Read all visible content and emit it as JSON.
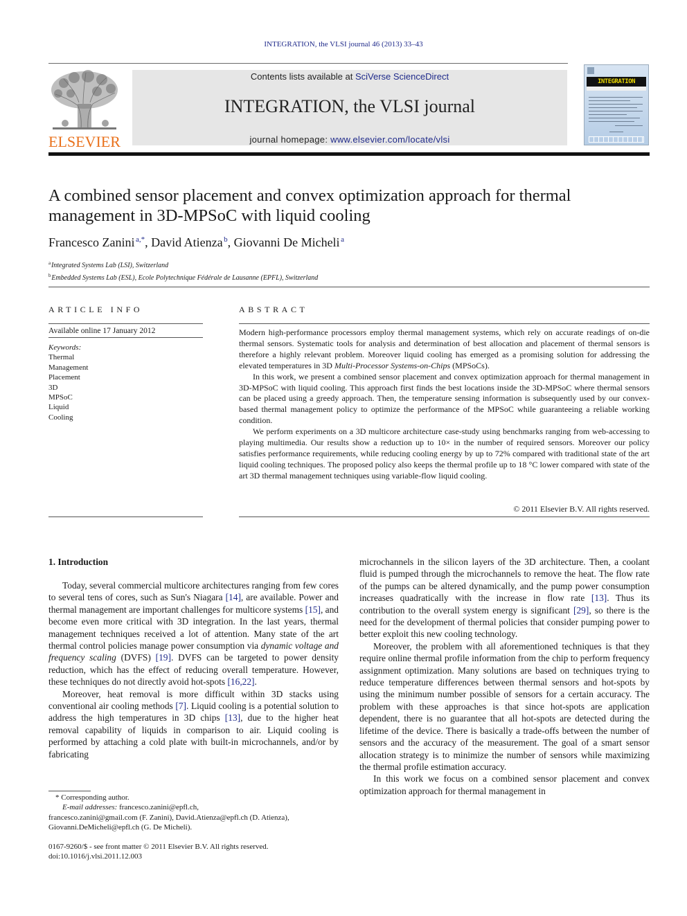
{
  "running_header": "INTEGRATION, the VLSI journal 46 (2013) 33–43",
  "publisher": {
    "logo_word": "ELSEVIER",
    "logo_color": "#e9711c"
  },
  "masthead": {
    "contents_prefix": "Contents lists available at ",
    "contents_link": "SciVerse ScienceDirect",
    "journal_name": "INTEGRATION, the VLSI journal",
    "homepage_prefix": "journal homepage: ",
    "homepage_link": "www.elsevier.com/locate/vlsi"
  },
  "cover": {
    "title": "INTEGRATION",
    "subtitle": "the VLSI journal"
  },
  "article": {
    "title": "A combined sensor placement and convex optimization approach for thermal management in 3D-MPSoC with liquid cooling",
    "authors": [
      {
        "name": "Francesco Zanini",
        "marks": "a,*"
      },
      {
        "name": "David Atienza",
        "marks": "b"
      },
      {
        "name": "Giovanni De Micheli",
        "marks": "a"
      }
    ],
    "affiliations": [
      {
        "mark": "a",
        "text": "Integrated Systems Lab (LSI), Switzerland"
      },
      {
        "mark": "b",
        "text": "Embedded Systems Lab (ESL), Ecole Polytechnique Fédérale de Lausanne (EPFL), Switzerland"
      }
    ]
  },
  "article_info": {
    "heading": "ARTICLE INFO",
    "available_online": "Available online 17 January 2012",
    "keywords_label": "Keywords:",
    "keywords": [
      "Thermal",
      "Management",
      "Placement",
      "3D",
      "MPSoC",
      "Liquid",
      "Cooling"
    ]
  },
  "abstract": {
    "heading": "ABSTRACT",
    "p1_a": "Modern high-performance processors employ thermal management systems, which rely on accurate readings of on-die thermal sensors. Systematic tools for analysis and determination of best allocation and placement of thermal sensors is therefore a highly relevant problem. Moreover liquid cooling has emerged as a promising solution for addressing the elevated temperatures in 3D ",
    "p1_italic": "Multi-Processor Systems-on-Chips",
    "p1_b": " (MPSoCs).",
    "p2": "In this work, we present a combined sensor placement and convex optimization approach for thermal management in 3D-MPSoC with liquid cooling. This approach first finds the best locations inside the 3D-MPSoC where thermal sensors can be placed using a greedy approach. Then, the temperature sensing information is subsequently used by our convex-based thermal management policy to optimize the performance of the MPSoC while guaranteeing a reliable working condition.",
    "p3": "We perform experiments on a 3D multicore architecture case-study using benchmarks ranging from web-accessing to playing multimedia. Our results show a reduction up to 10× in the number of required sensors. Moreover our policy satisfies performance requirements, while reducing cooling energy by up to 72% compared with traditional state of the art liquid cooling techniques. The proposed policy also keeps the thermal profile up to 18 °C lower compared with state of the art 3D thermal management techniques using variable-flow liquid cooling.",
    "copyright": "© 2011 Elsevier B.V. All rights reserved."
  },
  "introduction": {
    "heading": "1.   Introduction",
    "left_p1": [
      {
        "t": "Today, several commercial multicore architectures ranging from few cores to several tens of cores, such as Sun's Niagara "
      },
      {
        "r": "[14]"
      },
      {
        "t": ", are available. Power and thermal management are important challenges for multicore systems "
      },
      {
        "r": "[15]"
      },
      {
        "t": ", and become even more critical with 3D integration. In the last years, thermal management techniques received a lot of attention. Many state of the art thermal control policies manage power consumption via "
      },
      {
        "i": "dynamic voltage and frequency scaling"
      },
      {
        "t": " (DVFS) "
      },
      {
        "r": "[19]"
      },
      {
        "t": ". DVFS can be targeted to power density reduction, which has the effect of reducing overall temperature. However, these techniques do not directly avoid hot-spots "
      },
      {
        "r": "[16,22]"
      },
      {
        "t": "."
      }
    ],
    "left_p2": [
      {
        "t": "Moreover, heat removal is more difficult within 3D stacks using conventional air cooling methods "
      },
      {
        "r": "[7]"
      },
      {
        "t": ". Liquid cooling is a potential solution to address the high temperatures in 3D chips "
      },
      {
        "r": "[13]"
      },
      {
        "t": ", due to the higher heat removal capability of liquids in comparison to air. Liquid cooling is performed by attaching a cold plate with built-in microchannels, and/or by fabricating"
      }
    ],
    "right_p1": [
      {
        "t": "microchannels in the silicon layers of the 3D architecture. Then, a coolant fluid is pumped through the microchannels to remove the heat. The flow rate of the pumps can be altered dynamically, and the pump power consumption increases quadratically with the increase in flow rate "
      },
      {
        "r": "[13]"
      },
      {
        "t": ". Thus its contribution to the overall system energy is significant "
      },
      {
        "r": "[29]"
      },
      {
        "t": ", so there is the need for the development of thermal policies that consider pumping power to better exploit this new cooling technology."
      }
    ],
    "right_p2": [
      {
        "t": "Moreover, the problem with all aforementioned techniques is that they require online thermal profile information from the chip to perform frequency assignment optimization. Many solutions are based on techniques trying to reduce temperature differences between thermal sensors and hot-spots by using the minimum number possible of sensors for a certain accuracy. The problem with these approaches is that since hot-spots are application dependent, there is no guarantee that all hot-spots are detected during the lifetime of the device. There is basically a trade-offs between the number of sensors and the accuracy of the measurement. The goal of a smart sensor allocation strategy is to minimize the number of sensors while maximizing the thermal profile estimation accuracy."
      }
    ],
    "right_p3": [
      {
        "t": "In this work we focus on a combined sensor placement and convex optimization approach for thermal management in"
      }
    ]
  },
  "footnotes": {
    "corresponding": "* Corresponding author.",
    "email_label": "E-mail addresses:",
    "emails_line1": " francesco.zanini@epfl.ch,",
    "emails_rest": "francesco.zanini@gmail.com (F. Zanini), David.Atienza@epfl.ch (D. Atienza), Giovanni.DeMicheli@epfl.ch (G. De Micheli).",
    "front_matter": "0167-9260/$ - see front matter © 2011 Elsevier B.V. All rights reserved.",
    "doi": "doi:10.1016/j.vlsi.2011.12.003"
  }
}
